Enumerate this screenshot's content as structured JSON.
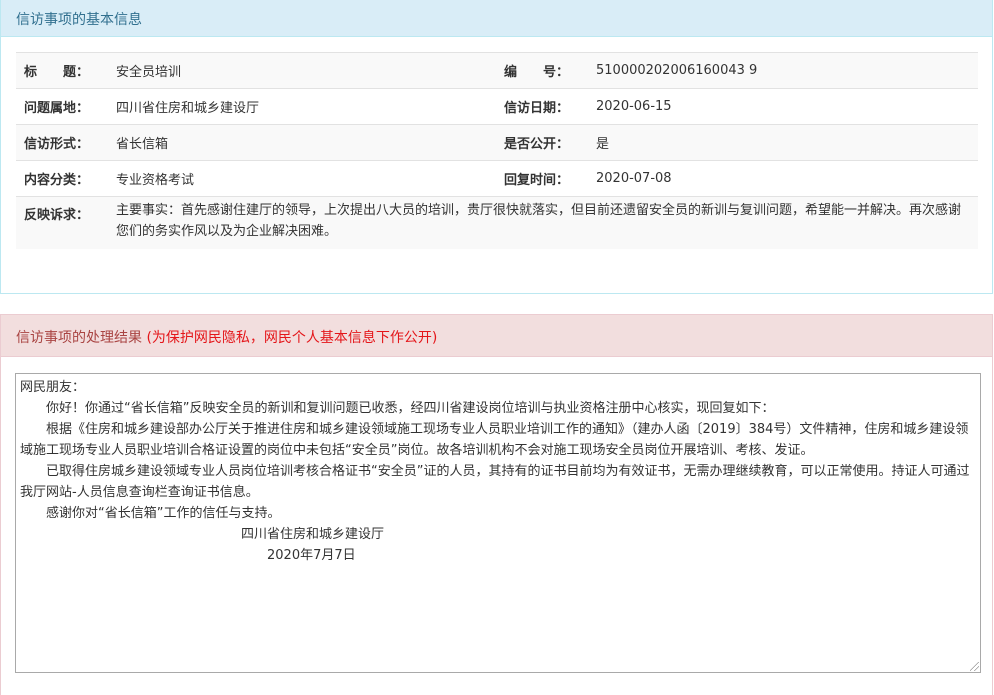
{
  "info_panel": {
    "title": "信访事项的基本信息",
    "rows": [
      {
        "label1": "标　　题：",
        "value1": "安全员培训",
        "label2": "编　　号：",
        "value2": "510000202006160043 9"
      },
      {
        "label1": "问题属地：",
        "value1": "四川省住房和城乡建设厅",
        "label2": "信访日期：",
        "value2": "2020-06-15"
      },
      {
        "label1": "信访形式：",
        "value1": "省长信箱",
        "label2": "是否公开：",
        "value2": "是"
      },
      {
        "label1": "内容分类：",
        "value1": "专业资格考试",
        "label2": "回复时间：",
        "value2": "2020-07-08"
      }
    ],
    "request_label": "反映诉求：",
    "request_text": "主要事实：首先感谢住建厅的领导，上次提出八大员的培训，贵厅很快就落实，但目前还遗留安全员的新训与复训问题，希望能一并解决。再次感谢您们的务实作风以及为企业解决困难。"
  },
  "result_panel": {
    "title": "信访事项的处理结果",
    "privacy_note": "(为保护网民隐私，网民个人基本信息下作公开)",
    "reply_lines": [
      "网民朋友：",
      "　　你好！你通过“省长信箱”反映安全员的新训和复训问题已收悉，经四川省建设岗位培训与执业资格注册中心核实，现回复如下：",
      "　　根据《住房和城乡建设部办公厅关于推进住房和城乡建设领域施工现场专业人员职业培训工作的通知》（建办人函〔2019〕384号）文件精神，住房和城乡建设领域施工现场专业人员职业培训合格证设置的岗位中未包括“安全员”岗位。故各培训机构不会对施工现场安全员岗位开展培训、考核、发证。",
      "　　已取得住房城乡建设领域专业人员岗位培训考核合格证书“安全员”证的人员，其持有的证书目前均为有效证书，无需办理继续教育，可以正常使用。持证人可通过我厅网站-人员信息查询栏查询证书信息。",
      "　　感谢你对“省长信箱”工作的信任与支持。",
      "",
      "",
      "　　　　　　　　　　　　　　　　　四川省住房和城乡建设厅",
      "　　　　　　　　　　　　　　　　　　　2020年7月7日"
    ]
  }
}
